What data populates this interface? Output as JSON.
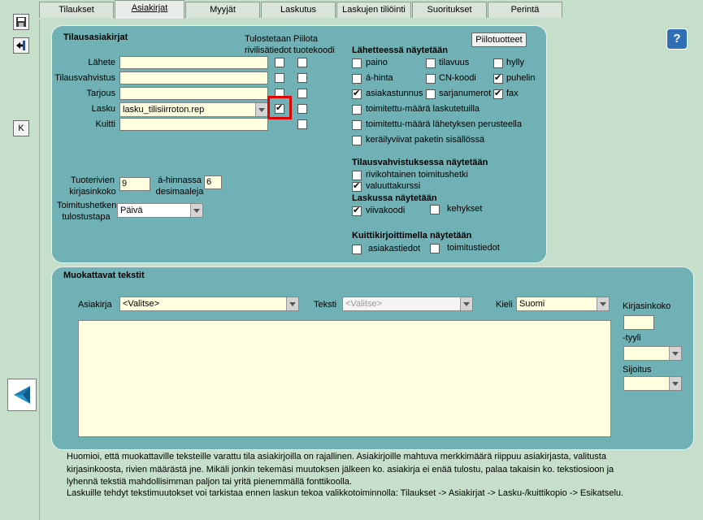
{
  "tabs": [
    {
      "label": "Tilaukset"
    },
    {
      "label": "Asiakirjat"
    },
    {
      "label": "Myyjät"
    },
    {
      "label": "Laskutus"
    },
    {
      "label": "Laskujen tiliöinti"
    },
    {
      "label": "Suoritukset"
    },
    {
      "label": "Perintä"
    }
  ],
  "sidebar": {
    "k_label": "K"
  },
  "docs": {
    "title": "Tilausasiakirjat",
    "col_print": "Tulostetaan rivilisätiedot",
    "col_hide": "Piilota tuotekoodi",
    "rows": [
      {
        "label": "Lähete",
        "value": "",
        "print": false,
        "hide": false
      },
      {
        "label": "Tilausvahvistus",
        "value": "",
        "print": false,
        "hide": false
      },
      {
        "label": "Tarjous",
        "value": "",
        "print": false,
        "hide": false
      },
      {
        "label": "Lasku",
        "value": "lasku_tilisiirroton.rep",
        "print": true,
        "hide": false
      },
      {
        "label": "Kuitti",
        "value": "",
        "print": null,
        "hide": false
      }
    ],
    "font_size_label": "Tuoterivien kirjasinkoko",
    "font_size_value": "9",
    "decimals_label": "á-hinnassa desimaaleja",
    "decimals_value": "6",
    "delivery_label": "Toimitushetken tulostustapa",
    "delivery_value": "Päivä"
  },
  "hidden_products_button": "Piilotuotteet",
  "help_icon": "question-icon",
  "shipment": {
    "title": "Lähetteessä näytetään",
    "opts": [
      {
        "label": "paino",
        "checked": false
      },
      {
        "label": "tilavuus",
        "checked": false
      },
      {
        "label": "hylly",
        "checked": false
      },
      {
        "label": "á-hinta",
        "checked": false
      },
      {
        "label": "CN-koodi",
        "checked": false
      },
      {
        "label": "puhelin",
        "checked": true
      },
      {
        "label": "asiakastunnus",
        "checked": true
      },
      {
        "label": "sarjanumerot",
        "checked": false
      },
      {
        "label": "fax",
        "checked": true
      },
      {
        "label": "toimitettu-määrä laskutetuilla",
        "checked": false
      },
      {
        "label": "toimitettu-määrä lähetyksen perusteella",
        "checked": false
      },
      {
        "label": "keräilyviivat paketin sisällössä",
        "checked": false
      }
    ]
  },
  "confirmation": {
    "title": "Tilausvahvistuksessa näytetään",
    "opts": [
      {
        "label": "rivikohtainen toimitushetki",
        "checked": false
      },
      {
        "label": "valuuttakurssi",
        "checked": true
      }
    ]
  },
  "invoice": {
    "title": "Laskussa näytetään",
    "opts": [
      {
        "label": "viivakoodi",
        "checked": true
      },
      {
        "label": "kehykset",
        "checked": false
      }
    ]
  },
  "receipt": {
    "title": "Kuittikirjoittimella näytetään",
    "opts": [
      {
        "label": "asiakastiedot",
        "checked": false
      },
      {
        "label": "toimitustiedot",
        "checked": false
      }
    ]
  },
  "custom": {
    "title": "Muokattavat tekstit",
    "doc_label": "Asiakirja",
    "doc_value": "<Valitse>",
    "text_label": "Teksti",
    "text_value": "<Valitse>",
    "lang_label": "Kieli",
    "lang_value": "Suomi",
    "font_size_label": "Kirjasinkoko",
    "style_label": "-tyyli",
    "position_label": "Sijoitus"
  },
  "notes": {
    "p1": "Huomioi, että muokattaville teksteille varattu tila asiakirjoilla on rajallinen. Asiakirjoille mahtuva merkkimäärä riippuu asiakirjasta, valitusta kirjasinkoosta, rivien määrästä jne. Mikäli jonkin tekemäsi muutoksen jälkeen ko. asiakirja ei enää tulostu, palaa takaisin ko. tekstiosioon ja lyhennä tekstiä mahdollisimman paljon tai yritä pienemmällä fonttikoolla.",
    "p2": "Laskuille tehdyt tekstimuutokset voi tarkistaa ennen laskun tekoa valikkotoiminnolla: Tilaukset -> Asiakirjat -> Lasku-/kuittikopio -> Esikatselu."
  },
  "colors": {
    "panel": "#6fb1b4",
    "background": "#c6dfcb",
    "input": "#ffffe0",
    "highlight": "#e00000"
  }
}
